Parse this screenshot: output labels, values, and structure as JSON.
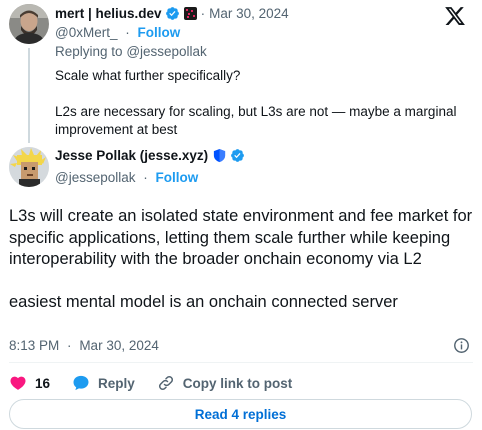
{
  "parent_tweet": {
    "author_name": "mert | helius.dev",
    "handle": "@0xMert_",
    "date": "Mar 30, 2024",
    "follow_label": "Follow",
    "replying_prefix": "Replying to",
    "replying_handle": "@jessepollak",
    "text_line1": "Scale what further specifically?",
    "text_line2": "L2s are necessary for scaling, but L3s are not — maybe a marginal improvement at best",
    "verified_icon": "blue-check-icon",
    "affiliate_icon": "org-badge-icon"
  },
  "main_tweet": {
    "author_name": "Jesse Pollak (jesse.xyz)",
    "handle": "@jessepollak",
    "follow_label": "Follow",
    "paragraph1": "L3s will create an isolated state environment and fee market for specific applications, letting them scale further while keeping interoperability with the broader onchain economy via L2",
    "paragraph2": "easiest mental model is an onchain connected server",
    "time": "8:13 PM",
    "date": "Mar 30, 2024"
  },
  "actions": {
    "like_count": "16",
    "reply_label": "Reply",
    "copy_link_label": "Copy link to post"
  },
  "read_replies_label": "Read 4 replies",
  "colors": {
    "accent_blue": "#1d9bf0",
    "like_pink": "#f91880",
    "text_primary": "#0f1419",
    "text_muted": "#536471"
  }
}
